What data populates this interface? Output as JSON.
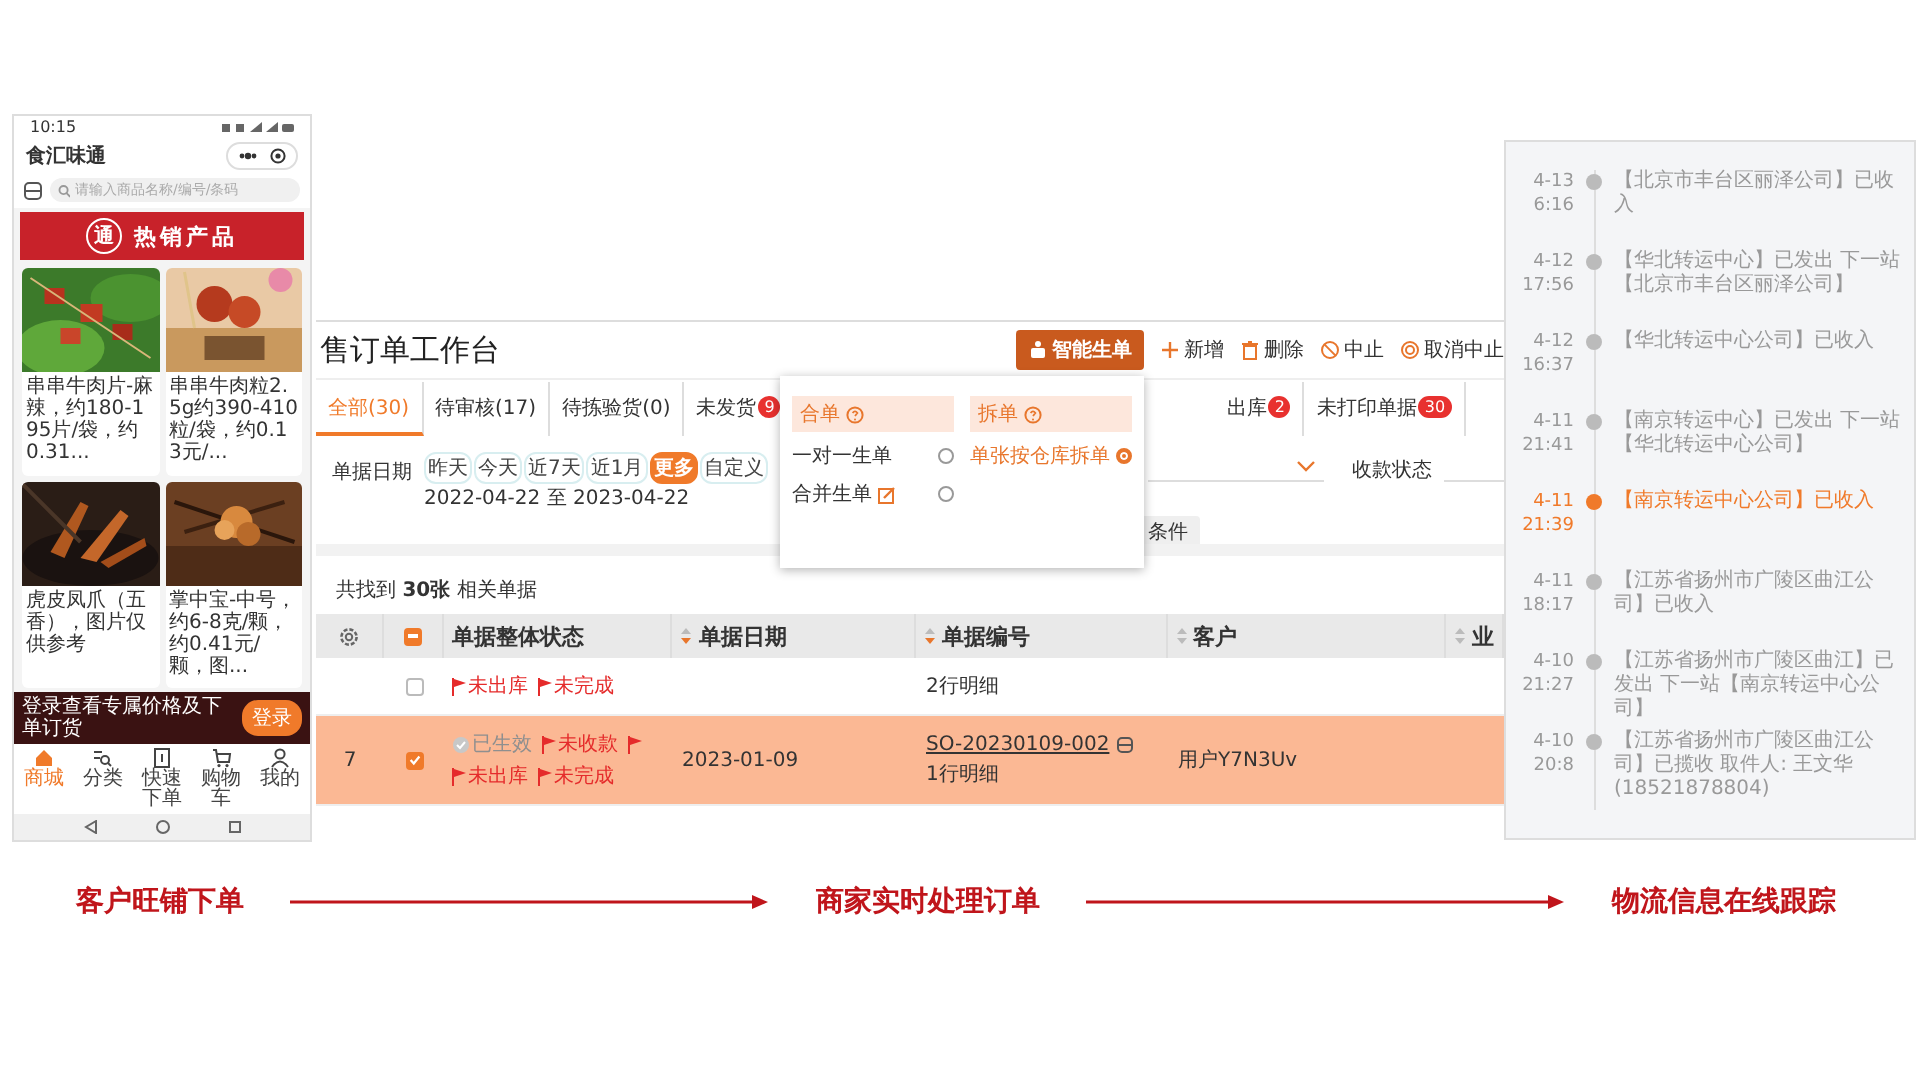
{
  "phone": {
    "time": "10:15",
    "app_title": "食汇味通",
    "search": {
      "placeholder": "请输入商品名称/编号/条码"
    },
    "banner": {
      "logo": "通",
      "title": "热销产品"
    },
    "products": [
      {
        "kind": "skewers",
        "description": "串串牛肉片-麻辣，约180-195片/袋，约0.31..."
      },
      {
        "kind": "cubes",
        "description": "串串牛肉粒2.5g约390-410粒/袋，约0.13元/..."
      },
      {
        "kind": "feet",
        "description": "虎皮凤爪（五香），图片仅供参考"
      },
      {
        "kind": "sticks",
        "description": "掌中宝-中号，约6-8克/颗，约0.41元/颗，图..."
      }
    ],
    "login_bar": {
      "text": "登录查看专属价格及下单订货",
      "button": "登录"
    },
    "nav": [
      {
        "kind": "home",
        "label": "商城",
        "selected": true
      },
      {
        "kind": "category",
        "label": "分类",
        "selected": false
      },
      {
        "kind": "quick",
        "label": "快速下单",
        "selected": false
      },
      {
        "kind": "cart",
        "label": "购物车",
        "selected": false
      },
      {
        "kind": "user",
        "label": "我的",
        "selected": false
      }
    ]
  },
  "order_window": {
    "title": "售订单工作台",
    "smart_button": "智能生单",
    "actions": [
      {
        "kind": "add",
        "label": "新增"
      },
      {
        "kind": "delete",
        "label": "删除"
      },
      {
        "kind": "stop",
        "label": "中止"
      },
      {
        "kind": "cancel",
        "label": "取消中止"
      }
    ],
    "tabs": [
      {
        "label": "全部(30)",
        "selected": true
      },
      {
        "label": "待审核(17)",
        "selected": false
      },
      {
        "label": "待拣验货(0)",
        "selected": false
      },
      {
        "label": "未发货",
        "badge": "9",
        "selected": false
      },
      {
        "label": "出库",
        "badge": "2",
        "selected": false
      },
      {
        "label": "未打印单据",
        "badge": "30",
        "selected": false
      }
    ],
    "date_filter": {
      "label": "单据日期",
      "chips": [
        {
          "label": "昨天",
          "selected": false
        },
        {
          "label": "今天",
          "selected": false
        },
        {
          "label": "近7天",
          "selected": false
        },
        {
          "label": "近1月",
          "selected": false
        },
        {
          "label": "更多",
          "selected": true
        },
        {
          "label": "自定义",
          "selected": false
        }
      ],
      "range": "2022-04-22 至 2023-04-22"
    },
    "status_filter": {
      "label": "收款状态"
    },
    "more_conditions": "条件",
    "result_count": "共找到 **30张** 相关单据",
    "table": {
      "header_indeterminate": true,
      "columns": [
        {
          "label": "单据整体状态",
          "sortable": false
        },
        {
          "label": "单据日期",
          "sortable": true,
          "sorted": true
        },
        {
          "label": "单据编号",
          "sortable": true,
          "sorted": true
        },
        {
          "label": "客户",
          "sortable": true,
          "sorted": false
        },
        {
          "label": "业",
          "sortable": true,
          "sorted": false
        }
      ],
      "rows": [
        {
          "checked": false,
          "selected": false,
          "status_lines": [
            [
              {
                "kind": "flag",
                "label": "未出库"
              },
              {
                "kind": "flag",
                "label": "未完成"
              }
            ]
          ],
          "detail": "2行明细"
        },
        {
          "number": "7",
          "checked": true,
          "selected": true,
          "status_lines": [
            [
              {
                "kind": "done",
                "label": "已生效"
              },
              {
                "kind": "flag",
                "label": "未收款"
              },
              {
                "kind": "flag"
              }
            ],
            [
              {
                "kind": "flag",
                "label": "未出库"
              },
              {
                "kind": "flag",
                "label": "未完成"
              }
            ]
          ],
          "date": "2023-01-09",
          "order_no": "SO-20230109-002",
          "detail": "1行明细",
          "customer": "用户Y7N3Uv"
        }
      ]
    },
    "popup": {
      "groups": [
        {
          "title": "合单",
          "options": [
            {
              "label": "一对一生单",
              "selected": false,
              "editable": false
            },
            {
              "label": "合并生单",
              "selected": false,
              "editable": true
            }
          ]
        },
        {
          "title": "拆单",
          "options": [
            {
              "label": "单张按仓库拆单",
              "selected": true,
              "editable": false
            }
          ]
        }
      ]
    }
  },
  "logistics": {
    "events": [
      {
        "date": "4-13",
        "time": "6:16",
        "text": "【北京市丰台区丽泽公司】已收入",
        "current": false
      },
      {
        "date": "4-12",
        "time": "17:56",
        "text": "【华北转运中心】已发出 下一站【北京市丰台区丽泽公司】",
        "current": false
      },
      {
        "date": "4-12",
        "time": "16:37",
        "text": "【华北转运中心公司】已收入",
        "current": false
      },
      {
        "date": "4-11",
        "time": "21:41",
        "text": "【南京转运中心】已发出 下一站【华北转运中心公司】",
        "current": false
      },
      {
        "date": "4-11",
        "time": "21:39",
        "text": "【南京转运中心公司】已收入",
        "current": true
      },
      {
        "date": "4-11",
        "time": "18:17",
        "text": "【江苏省扬州市广陵区曲江公司】已收入",
        "current": false
      },
      {
        "date": "4-10",
        "time": "21:27",
        "text": "【江苏省扬州市广陵区曲江】已发出 下一站【南京转运中心公司】",
        "current": false
      },
      {
        "date": "4-10",
        "time": "20:8",
        "text": "【江苏省扬州市广陵区曲江公司】已揽收 取件人: 王文华 (18521878804)",
        "current": false
      }
    ]
  },
  "captions": [
    "客户旺铺下单",
    "商家实时处理订单",
    "物流信息在线跟踪"
  ]
}
